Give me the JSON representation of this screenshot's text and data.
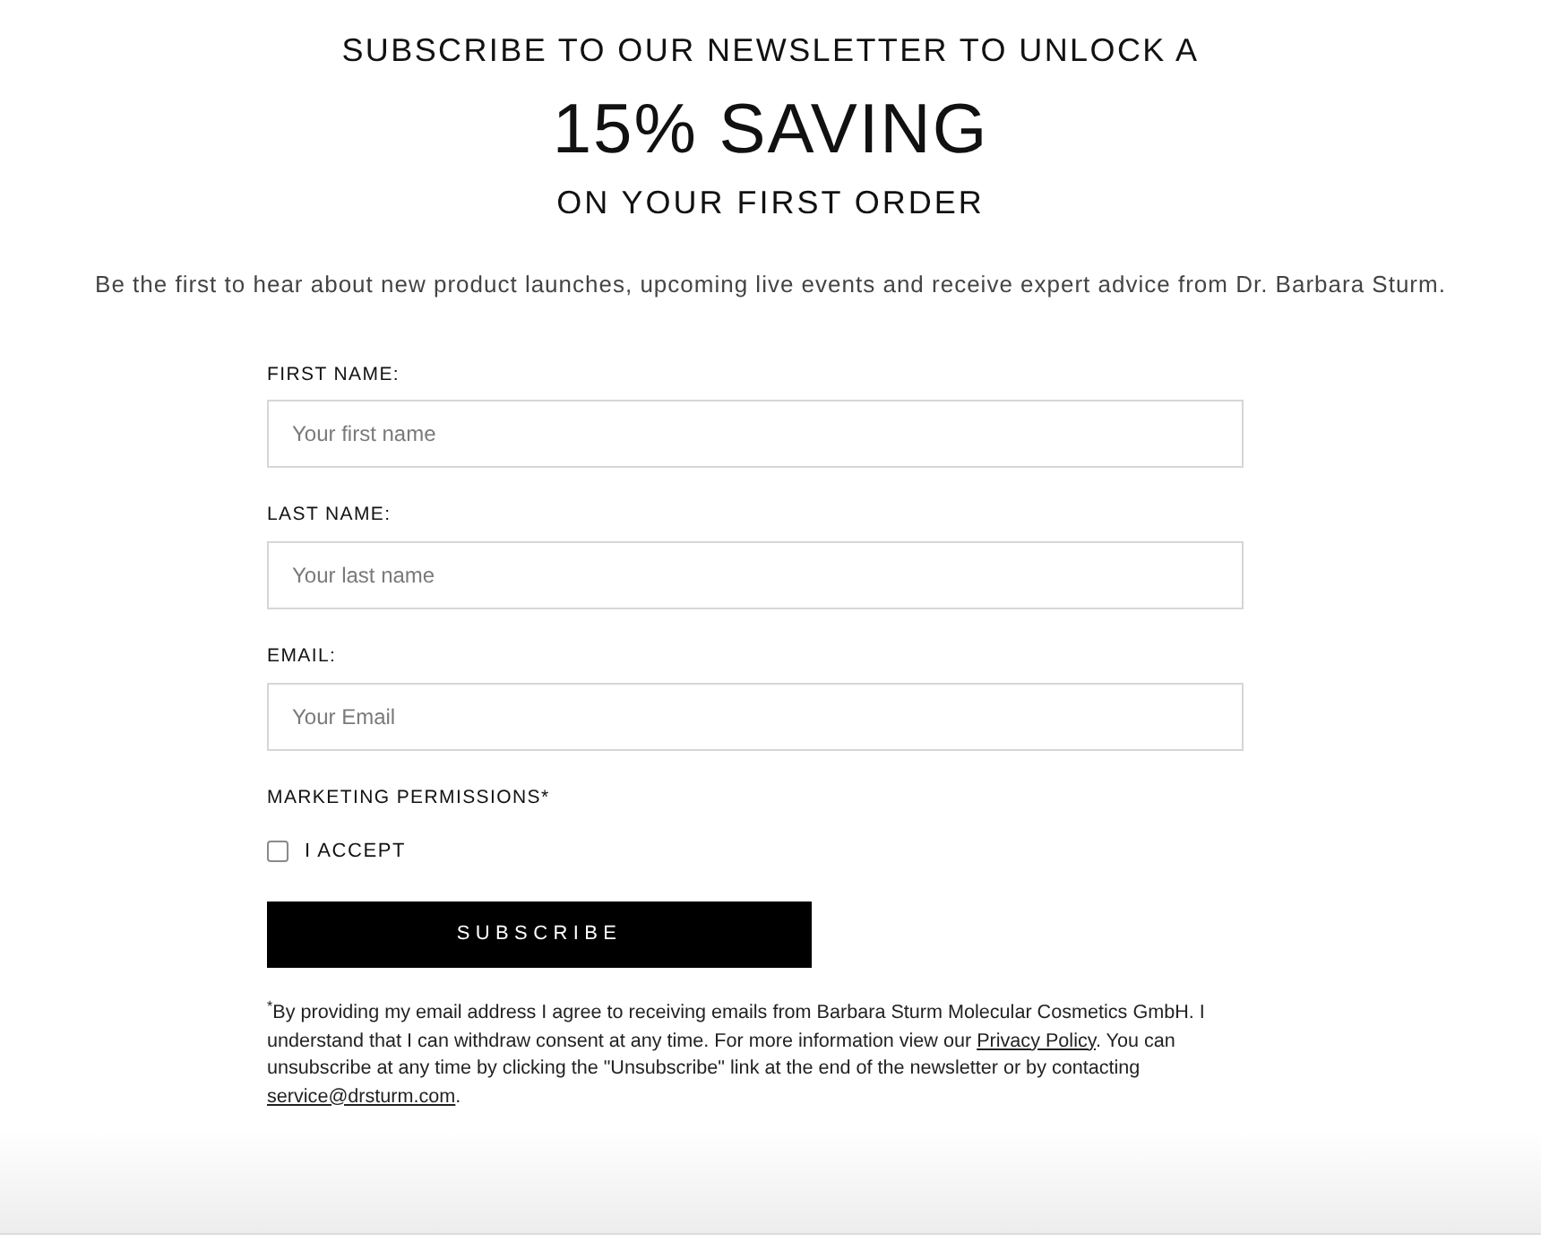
{
  "heading": {
    "line_1": "SUBSCRIBE TO OUR NEWSLETTER TO UNLOCK A",
    "line_2": "15% SAVING",
    "line_3": "ON YOUR FIRST ORDER"
  },
  "intro": "Be the first to hear about new product launches, upcoming live events and receive expert advice from Dr. Barbara Sturm.",
  "fields": [
    {
      "label": "FIRST NAME:",
      "placeholder": "Your first name"
    },
    {
      "label": "LAST NAME:",
      "placeholder": "Your last name"
    },
    {
      "label": "EMAIL:",
      "placeholder": "Your Email"
    }
  ],
  "permissions": {
    "label": "MARKETING PERMISSIONS*",
    "checkbox": {
      "label": "I ACCEPT",
      "checked": false
    }
  },
  "button": "SUBSCRIBE",
  "disclaimer": [
    {
      "kind": "text",
      "text": "$^{*}$By providing my email address I agree to receiving emails from Barbara Sturm Molecular Cosmetics GmbH. I understand that I can withdraw consent at any time. For more information view our "
    },
    {
      "kind": "link",
      "text": "Privacy Policy"
    },
    {
      "kind": "text",
      "text": ". You can unsubscribe at any time by clicking the \"Unsubscribe\" link at the end of the newsletter or by contacting "
    },
    {
      "kind": "link",
      "text": "service@drsturm.com"
    },
    {
      "kind": "text",
      "text": "."
    }
  ]
}
